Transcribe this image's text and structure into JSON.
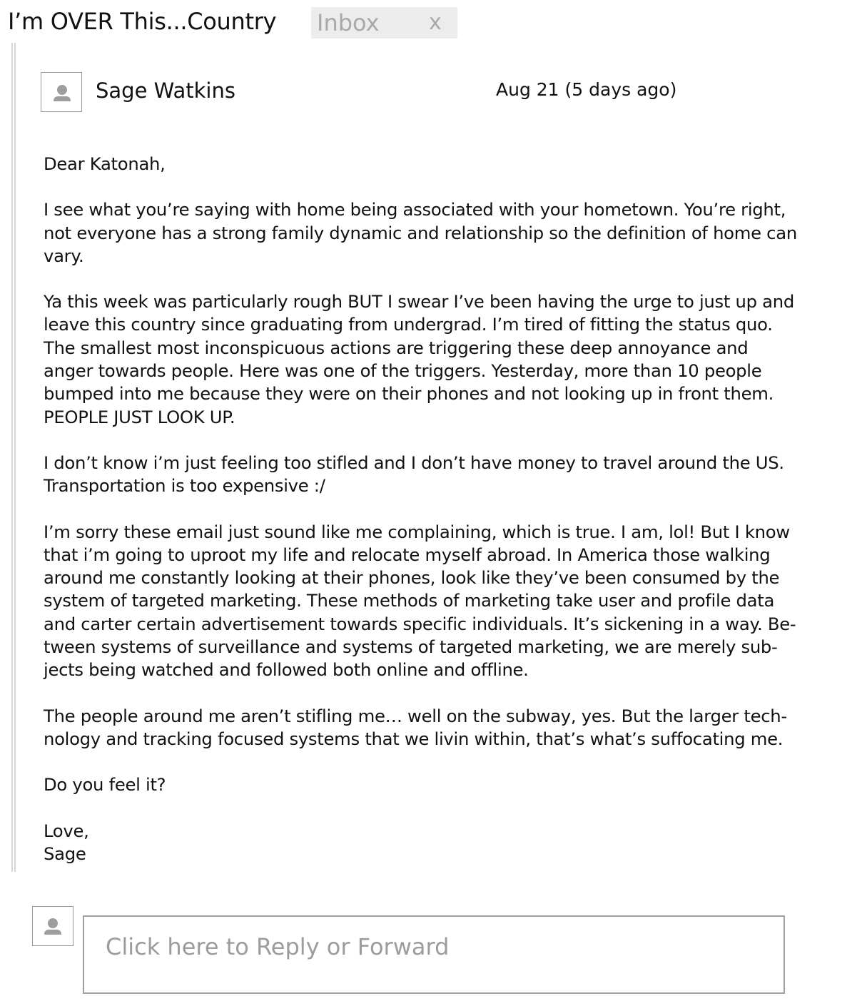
{
  "header": {
    "subject": "I’m OVER This...Country",
    "label": "Inbox",
    "label_remove": "x"
  },
  "message": {
    "sender": "Sage Watkins",
    "date": "Aug 21 (5 days ago)",
    "greeting": "Dear Katonah,",
    "paragraphs": [
      "I see what you’re saying with home being associated with your hometown. You’re right,\nnot everyone has a strong family dynamic and relationship so the definition of home can\nvary.",
      "Ya this week was particularly rough BUT I swear I’ve been having the urge to just up and\nleave this country since graduating from undergrad. I’m tired of fitting the status quo.\nThe smallest most inconspicuous actions are triggering these deep annoyance and\nanger towards people. Here was one of the triggers. Yesterday, more than 10 people\nbumped into me because they were on their phones and not looking up in front them.\nPEOPLE JUST LOOK UP.",
      "I don’t know i’m just feeling too stifled and I don’t have money to travel around the US.\nTransportation is too expensive :/",
      "I’m sorry these email just sound like me complaining, which is true. I am, lol! But I know\nthat i’m going to uproot my life and relocate myself abroad. In America those walking\naround me constantly looking at their phones, look like they’ve been consumed by the\nsystem of targeted marketing. These methods of marketing take user and profile data\nand carter certain advertisement towards specific individuals. It’s sickening in a way. Be-\ntween systems of surveillance and systems of targeted marketing, we are merely sub-\njects being watched and followed both online and offline.",
      "The people around me aren’t stifling me… well on the subway, yes. But the larger tech-\nnology and tracking focused systems that we livin within, that’s what’s suffocating me.",
      "Do you feel it?"
    ],
    "signoff": "Love,\nSage"
  },
  "reply": {
    "placeholder": "Click here to Reply or Forward"
  }
}
